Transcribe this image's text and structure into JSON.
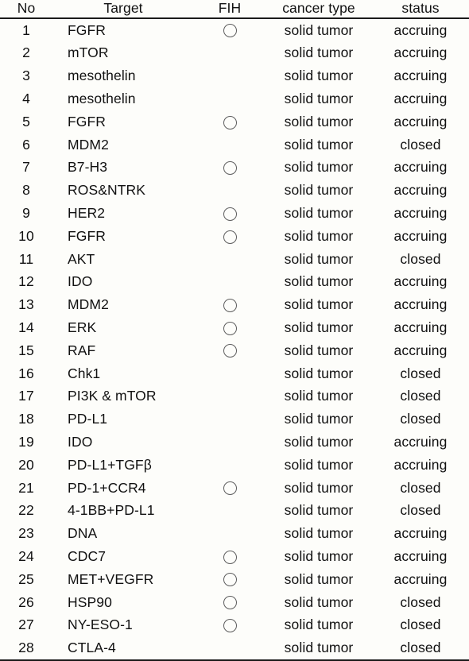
{
  "table": {
    "columns": [
      {
        "key": "no",
        "label": "No"
      },
      {
        "key": "target",
        "label": "Target"
      },
      {
        "key": "fih",
        "label": "FIH"
      },
      {
        "key": "cancer",
        "label": "cancer type"
      },
      {
        "key": "status",
        "label": "status"
      }
    ],
    "fih_marker_icon": "hollow-circle-icon",
    "rows": [
      {
        "no": "1",
        "target": "FGFR",
        "fih": true,
        "cancer": "solid tumor",
        "status": "accruing"
      },
      {
        "no": "2",
        "target": "mTOR",
        "fih": false,
        "cancer": "solid tumor",
        "status": "accruing"
      },
      {
        "no": "3",
        "target": "mesothelin",
        "fih": false,
        "cancer": "solid tumor",
        "status": "accruing"
      },
      {
        "no": "4",
        "target": "mesothelin",
        "fih": false,
        "cancer": "solid tumor",
        "status": "accruing"
      },
      {
        "no": "5",
        "target": "FGFR",
        "fih": true,
        "cancer": "solid tumor",
        "status": "accruing"
      },
      {
        "no": "6",
        "target": "MDM2",
        "fih": false,
        "cancer": "solid tumor",
        "status": "closed"
      },
      {
        "no": "7",
        "target": "B7-H3",
        "fih": true,
        "cancer": "solid tumor",
        "status": "accruing"
      },
      {
        "no": "8",
        "target": "ROS&NTRK",
        "fih": false,
        "cancer": "solid tumor",
        "status": "accruing"
      },
      {
        "no": "9",
        "target": "HER2",
        "fih": true,
        "cancer": "solid tumor",
        "status": "accruing"
      },
      {
        "no": "10",
        "target": "FGFR",
        "fih": true,
        "cancer": "solid tumor",
        "status": "accruing"
      },
      {
        "no": "11",
        "target": "AKT",
        "fih": false,
        "cancer": "solid tumor",
        "status": "closed"
      },
      {
        "no": "12",
        "target": "IDO",
        "fih": false,
        "cancer": "solid tumor",
        "status": "accruing"
      },
      {
        "no": "13",
        "target": "MDM2",
        "fih": true,
        "cancer": "solid tumor",
        "status": "accruing"
      },
      {
        "no": "14",
        "target": "ERK",
        "fih": true,
        "cancer": "solid tumor",
        "status": "accruing"
      },
      {
        "no": "15",
        "target": "RAF",
        "fih": true,
        "cancer": "solid tumor",
        "status": "accruing"
      },
      {
        "no": "16",
        "target": "Chk1",
        "fih": false,
        "cancer": "solid tumor",
        "status": "closed"
      },
      {
        "no": "17",
        "target": "PI3K & mTOR",
        "fih": false,
        "cancer": "solid tumor",
        "status": "closed"
      },
      {
        "no": "18",
        "target": "PD-L1",
        "fih": false,
        "cancer": "solid tumor",
        "status": "closed"
      },
      {
        "no": "19",
        "target": "IDO",
        "fih": false,
        "cancer": "solid tumor",
        "status": "accruing"
      },
      {
        "no": "20",
        "target": "PD-L1+TGFβ",
        "fih": false,
        "cancer": "solid tumor",
        "status": "accruing"
      },
      {
        "no": "21",
        "target": "PD-1+CCR4",
        "fih": true,
        "cancer": "solid tumor",
        "status": "closed"
      },
      {
        "no": "22",
        "target": "4-1BB+PD-L1",
        "fih": false,
        "cancer": "solid tumor",
        "status": "closed"
      },
      {
        "no": "23",
        "target": "DNA",
        "fih": false,
        "cancer": "solid tumor",
        "status": "accruing"
      },
      {
        "no": "24",
        "target": "CDC7",
        "fih": true,
        "cancer": "solid tumor",
        "status": "accruing"
      },
      {
        "no": "25",
        "target": "MET+VEGFR",
        "fih": true,
        "cancer": "solid tumor",
        "status": "accruing"
      },
      {
        "no": "26",
        "target": "HSP90",
        "fih": true,
        "cancer": "solid tumor",
        "status": "closed"
      },
      {
        "no": "27",
        "target": "NY-ESO-1",
        "fih": true,
        "cancer": "solid tumor",
        "status": "closed"
      },
      {
        "no": "28",
        "target": "CTLA-4",
        "fih": false,
        "cancer": "solid tumor",
        "status": "closed"
      }
    ]
  },
  "colors": {
    "background": "#fdfdfa",
    "text": "#111111",
    "rule": "#1a1a1a",
    "circle_stroke": "#5d5d5d"
  }
}
